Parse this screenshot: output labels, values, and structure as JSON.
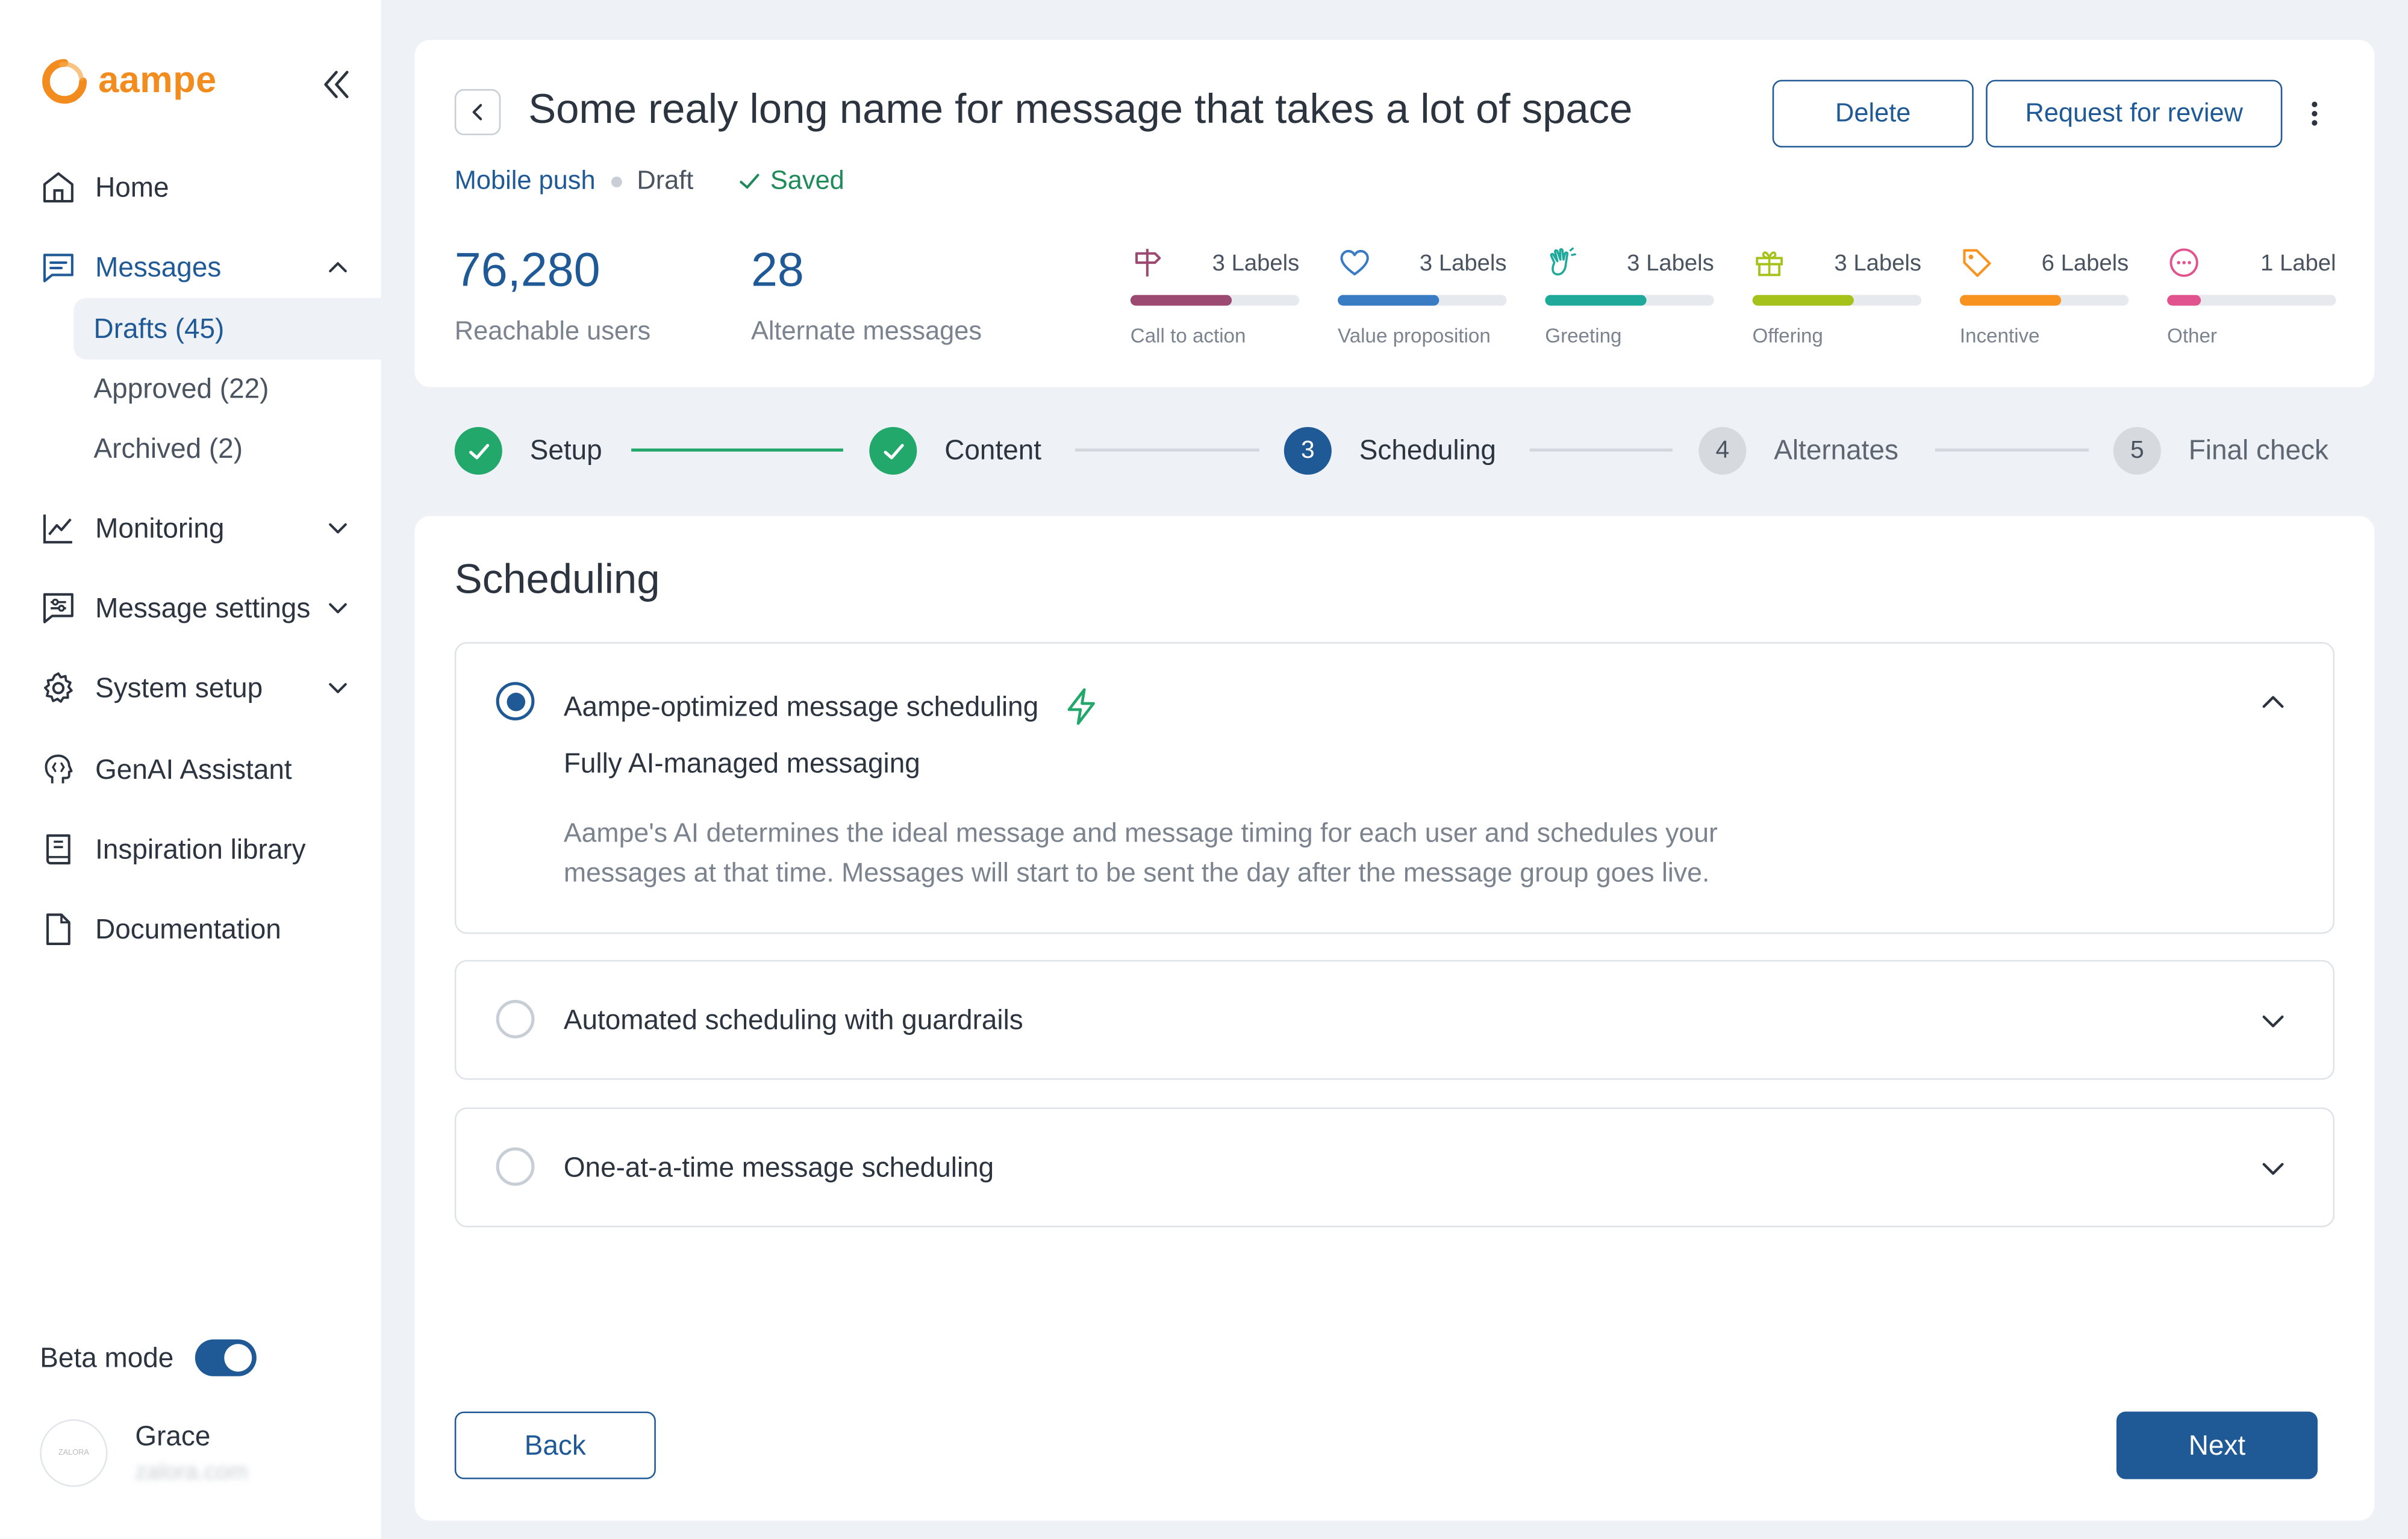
{
  "brand": {
    "name": "aampe",
    "accent": "#f28c1e",
    "primary": "#1f5a96",
    "success": "#22a86b"
  },
  "sidebar": {
    "collapse_icon": "double-chevron-left-icon",
    "items": [
      {
        "label": "Home",
        "icon": "home-icon"
      },
      {
        "label": "Messages",
        "icon": "messages-icon",
        "expanded": true
      },
      {
        "label": "Monitoring",
        "icon": "chart-line-icon"
      },
      {
        "label": "Message settings",
        "icon": "message-settings-icon"
      },
      {
        "label": "System setup",
        "icon": "gear-icon"
      },
      {
        "label": "GenAI Assistant",
        "icon": "ai-brain-icon"
      },
      {
        "label": "Inspiration library",
        "icon": "book-icon"
      },
      {
        "label": "Documentation",
        "icon": "document-icon"
      }
    ],
    "messages_sub": [
      {
        "label": "Drafts (45)",
        "selected": true
      },
      {
        "label": "Approved (22)"
      },
      {
        "label": "Archived (2)"
      }
    ],
    "beta_mode": {
      "label": "Beta mode",
      "on": true
    },
    "user": {
      "name": "Grace",
      "org": "zalora.com",
      "avatar_text": "ZALORA"
    }
  },
  "header": {
    "title": "Some realy long name for message that takes a lot of space",
    "channel": "Mobile push",
    "status": "Draft",
    "saved": "Saved",
    "delete_label": "Delete",
    "review_label": "Request for review",
    "stats": [
      {
        "value": "76,280",
        "label": "Reachable users"
      },
      {
        "value": "28",
        "label": "Alternate messages"
      }
    ],
    "labels": [
      {
        "count": "3 Labels",
        "name": "Call to action",
        "icon": "signpost-icon",
        "color": "#9c4a72",
        "fill": 0.6
      },
      {
        "count": "3 Labels",
        "name": "Value proposition",
        "icon": "heart-icon",
        "color": "#3a7cc4",
        "fill": 0.6
      },
      {
        "count": "3 Labels",
        "name": "Greeting",
        "icon": "waving-hand-icon",
        "color": "#1ea99a",
        "fill": 0.6
      },
      {
        "count": "3 Labels",
        "name": "Offering",
        "icon": "gift-icon",
        "color": "#a5c21a",
        "fill": 0.6
      },
      {
        "count": "6 Labels",
        "name": "Incentive",
        "icon": "tag-icon",
        "color": "#f7931e",
        "fill": 0.6
      },
      {
        "count": "1 Label",
        "name": "Other",
        "icon": "ellipsis-circle-icon",
        "color": "#e0538f",
        "fill": 0.2
      }
    ]
  },
  "stepper": [
    {
      "label": "Setup",
      "number": "1",
      "state": "done"
    },
    {
      "label": "Content",
      "number": "2",
      "state": "done"
    },
    {
      "label": "Scheduling",
      "number": "3",
      "state": "current"
    },
    {
      "label": "Alternates",
      "number": "4",
      "state": "todo"
    },
    {
      "label": "Final check",
      "number": "5",
      "state": "todo"
    }
  ],
  "scheduling": {
    "title": "Scheduling",
    "options": [
      {
        "title": "Aampe-optimized message scheduling",
        "selected": true,
        "expanded": true,
        "badge_icon": "lightning-icon",
        "subtitle": "Fully AI-managed messaging",
        "description": "Aampe's AI determines the ideal message and message timing for each user and schedules your messages at that time. Messages will start to be sent the day after the message group goes live."
      },
      {
        "title": "Automated scheduling with guardrails",
        "selected": false,
        "expanded": false
      },
      {
        "title": "One-at-a-time message scheduling",
        "selected": false,
        "expanded": false
      }
    ],
    "back_label": "Back",
    "next_label": "Next"
  }
}
